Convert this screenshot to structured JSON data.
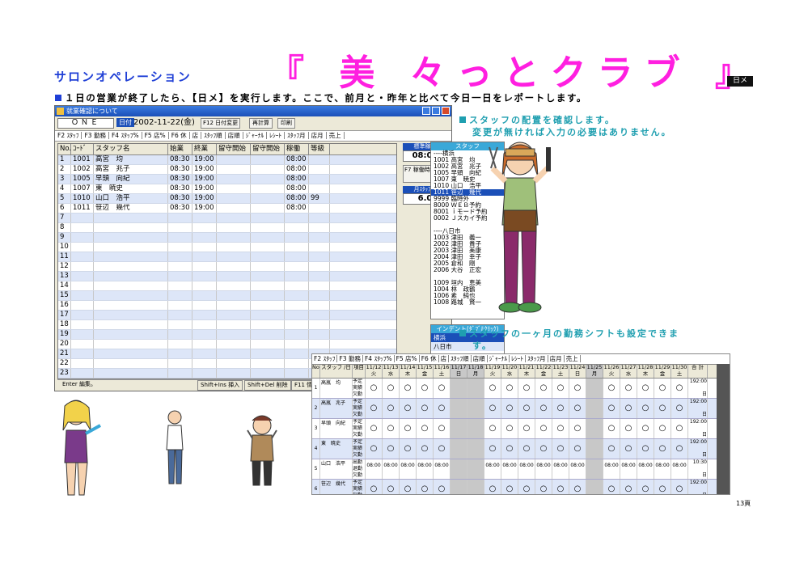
{
  "header": {
    "subtitle": "サロンオペレーション",
    "title": "『 美 々っとクラブ 』",
    "badge": "日メ"
  },
  "intro_text": "１日の営業が終了したら、【日メ】を実行します。ここで、前月と・昨年と比べて今日一日をレポートします。",
  "note1_line1": "スタッフの配置を確認します。",
  "note1_line2": "変更が無ければ入力の必要はありません。",
  "note2_line1": "スタッフの一ヶ月の勤務シフトも設定できま",
  "note2_line2": "す。",
  "window": {
    "title": "就業確認について",
    "store": "ＯＮＥ",
    "date_label": "日付",
    "date": "2002-11-22(金)",
    "btn_f12": "F12 日付変更",
    "btn_recalc": "再計算",
    "btn_print": "印刷",
    "tabs": [
      "F2 ｽﾀｯﾌ",
      "F3 勤務",
      "F4 ｽﾀｯﾌ%",
      "F5 店%",
      "F6 休",
      "店",
      "ｽﾀｯﾌ順",
      "店順",
      "ｼﾞｬｰﾅﾙ",
      "ﾚｼｰﾄ",
      "ｽﾀｯﾌ月",
      "店月",
      "売上"
    ],
    "columns": [
      "No.",
      "ｺｰﾄﾞ",
      "スタッフ名",
      "始業",
      "終業",
      "留守開始",
      "留守開始",
      "稼働",
      "等級"
    ],
    "rows": [
      {
        "no": "1",
        "code": "1001",
        "name": "高宮　均",
        "start": "08:30",
        "end": "19:00",
        "work": "08:00",
        "grade": ""
      },
      {
        "no": "2",
        "code": "1002",
        "name": "高宮　兆子",
        "start": "08:30",
        "end": "19:00",
        "work": "08:00",
        "grade": ""
      },
      {
        "no": "3",
        "code": "1005",
        "name": "早頭　向紀",
        "start": "08:30",
        "end": "19:00",
        "work": "08:00",
        "grade": ""
      },
      {
        "no": "4",
        "code": "1007",
        "name": "東　暁史",
        "start": "08:30",
        "end": "19:00",
        "work": "08:00",
        "grade": ""
      },
      {
        "no": "5",
        "code": "1010",
        "name": "山口　浩平",
        "start": "08:30",
        "end": "19:00",
        "work": "08:00",
        "grade": "99"
      },
      {
        "no": "6",
        "code": "1011",
        "name": "笹辺　幾代",
        "start": "08:30",
        "end": "19:00",
        "work": "08:00",
        "grade": ""
      }
    ],
    "empty_rows": [
      "7",
      "8",
      "9",
      "10",
      "11",
      "12",
      "13",
      "14",
      "15",
      "16",
      "17",
      "18",
      "19",
      "20",
      "21",
      "22",
      "23",
      "24",
      "25"
    ],
    "std_label": "標準稼働",
    "std_value": "08:00",
    "f7_label": "F7 稼働時間",
    "month_label": "月ｽﾀｯﾌ数",
    "month_value": "6.0",
    "staff_header": "スタッフ",
    "staff_group1": "----横浜",
    "staff_list1": [
      "1001 高宮　均",
      "1002 高宮　兆子",
      "1005 早頭　向紀",
      "1007 東　暁史",
      "1010 山口　浩平"
    ],
    "staff_selected": "1011 笹辺　幾代",
    "staff_list1b": [
      "9999 臨時外",
      "8000 ＷＥＢ予約",
      "8001 ｉモード予約",
      "0002 Ｊスカイ予約"
    ],
    "staff_group2": "----八日市",
    "staff_list2": [
      "1003 津田　義一",
      "2002 津田　貴子",
      "2003 津田　美康",
      "2004 津田　幸子",
      "2005 倉和　剛",
      "2006 大谷　正宏"
    ],
    "staff_list3": [
      "1009 垣内　恵美",
      "1004 林　政鶴",
      "1006 素　純也",
      "1008 路城　賢一"
    ],
    "indent_header": "インデント(ﾀﾞﾌﾞﾙｸﾘｯｸ)",
    "indent_items": [
      "横浜",
      "八日市"
    ],
    "status_left": "Enter 編集。",
    "status_btns": [
      "Shift+Ins 挿入",
      "Shift+Del 削除",
      "F11 情報"
    ]
  },
  "shift": {
    "tabs": [
      "F2 ｽﾀｯﾌ",
      "F3 勤務",
      "F4 ｽﾀｯﾌ%",
      "F5 店%",
      "F6 休",
      "店",
      "ｽﾀｯﾌ順",
      "店順",
      "ｼﾞｬｰﾅﾙ",
      "ﾚｼｰﾄ",
      "ｽﾀｯﾌ月",
      "店月",
      "売上"
    ],
    "col_no": "No.",
    "col_staff": "スタッフ /日",
    "col_item": "項目",
    "col_total": "合 計",
    "dates": [
      [
        "11/12",
        "火"
      ],
      [
        "11/13",
        "水"
      ],
      [
        "11/14",
        "木"
      ],
      [
        "11/15",
        "金"
      ],
      [
        "11/16",
        "土"
      ],
      [
        "11/17",
        "日"
      ],
      [
        "11/18",
        "月"
      ],
      [
        "11/19",
        "火"
      ],
      [
        "11/20",
        "水"
      ],
      [
        "11/21",
        "木"
      ],
      [
        "11/22",
        "金"
      ],
      [
        "11/23",
        "土"
      ],
      [
        "11/24",
        "日"
      ],
      [
        "11/25",
        "月"
      ],
      [
        "11/26",
        "火"
      ],
      [
        "11/27",
        "水"
      ],
      [
        "11/28",
        "木"
      ],
      [
        "11/29",
        "金"
      ],
      [
        "11/30",
        "土"
      ]
    ],
    "rows": [
      {
        "no": "1",
        "name": "高嵐　均",
        "items": [
          "予定",
          "実績",
          "欠勤"
        ],
        "total": "192:00",
        "total2": "日"
      },
      {
        "no": "2",
        "name": "高嵐　兆子",
        "items": [
          "予定",
          "実績",
          "欠勤"
        ],
        "total": "192:00",
        "total2": "日"
      },
      {
        "no": "3",
        "name": "早頭　向紀",
        "items": [
          "予定",
          "実績",
          "欠勤"
        ],
        "total": "192:00",
        "total2": "日"
      },
      {
        "no": "4",
        "name": "東　暁史",
        "items": [
          "予定",
          "実績",
          "欠勤"
        ],
        "total": "192:00",
        "total2": "日"
      },
      {
        "no": "5",
        "name": "山口　浩平",
        "items": [
          "出勤",
          "退勤",
          "欠勤"
        ],
        "total": "10:30",
        "total2": "日"
      },
      {
        "no": "6",
        "name": "笹辺　幾代",
        "items": [
          "予定",
          "実績",
          "欠勤"
        ],
        "total": "192:00",
        "total2": "日"
      }
    ],
    "mark": "○",
    "time_in": "08:00"
  },
  "page_number": "13頁"
}
